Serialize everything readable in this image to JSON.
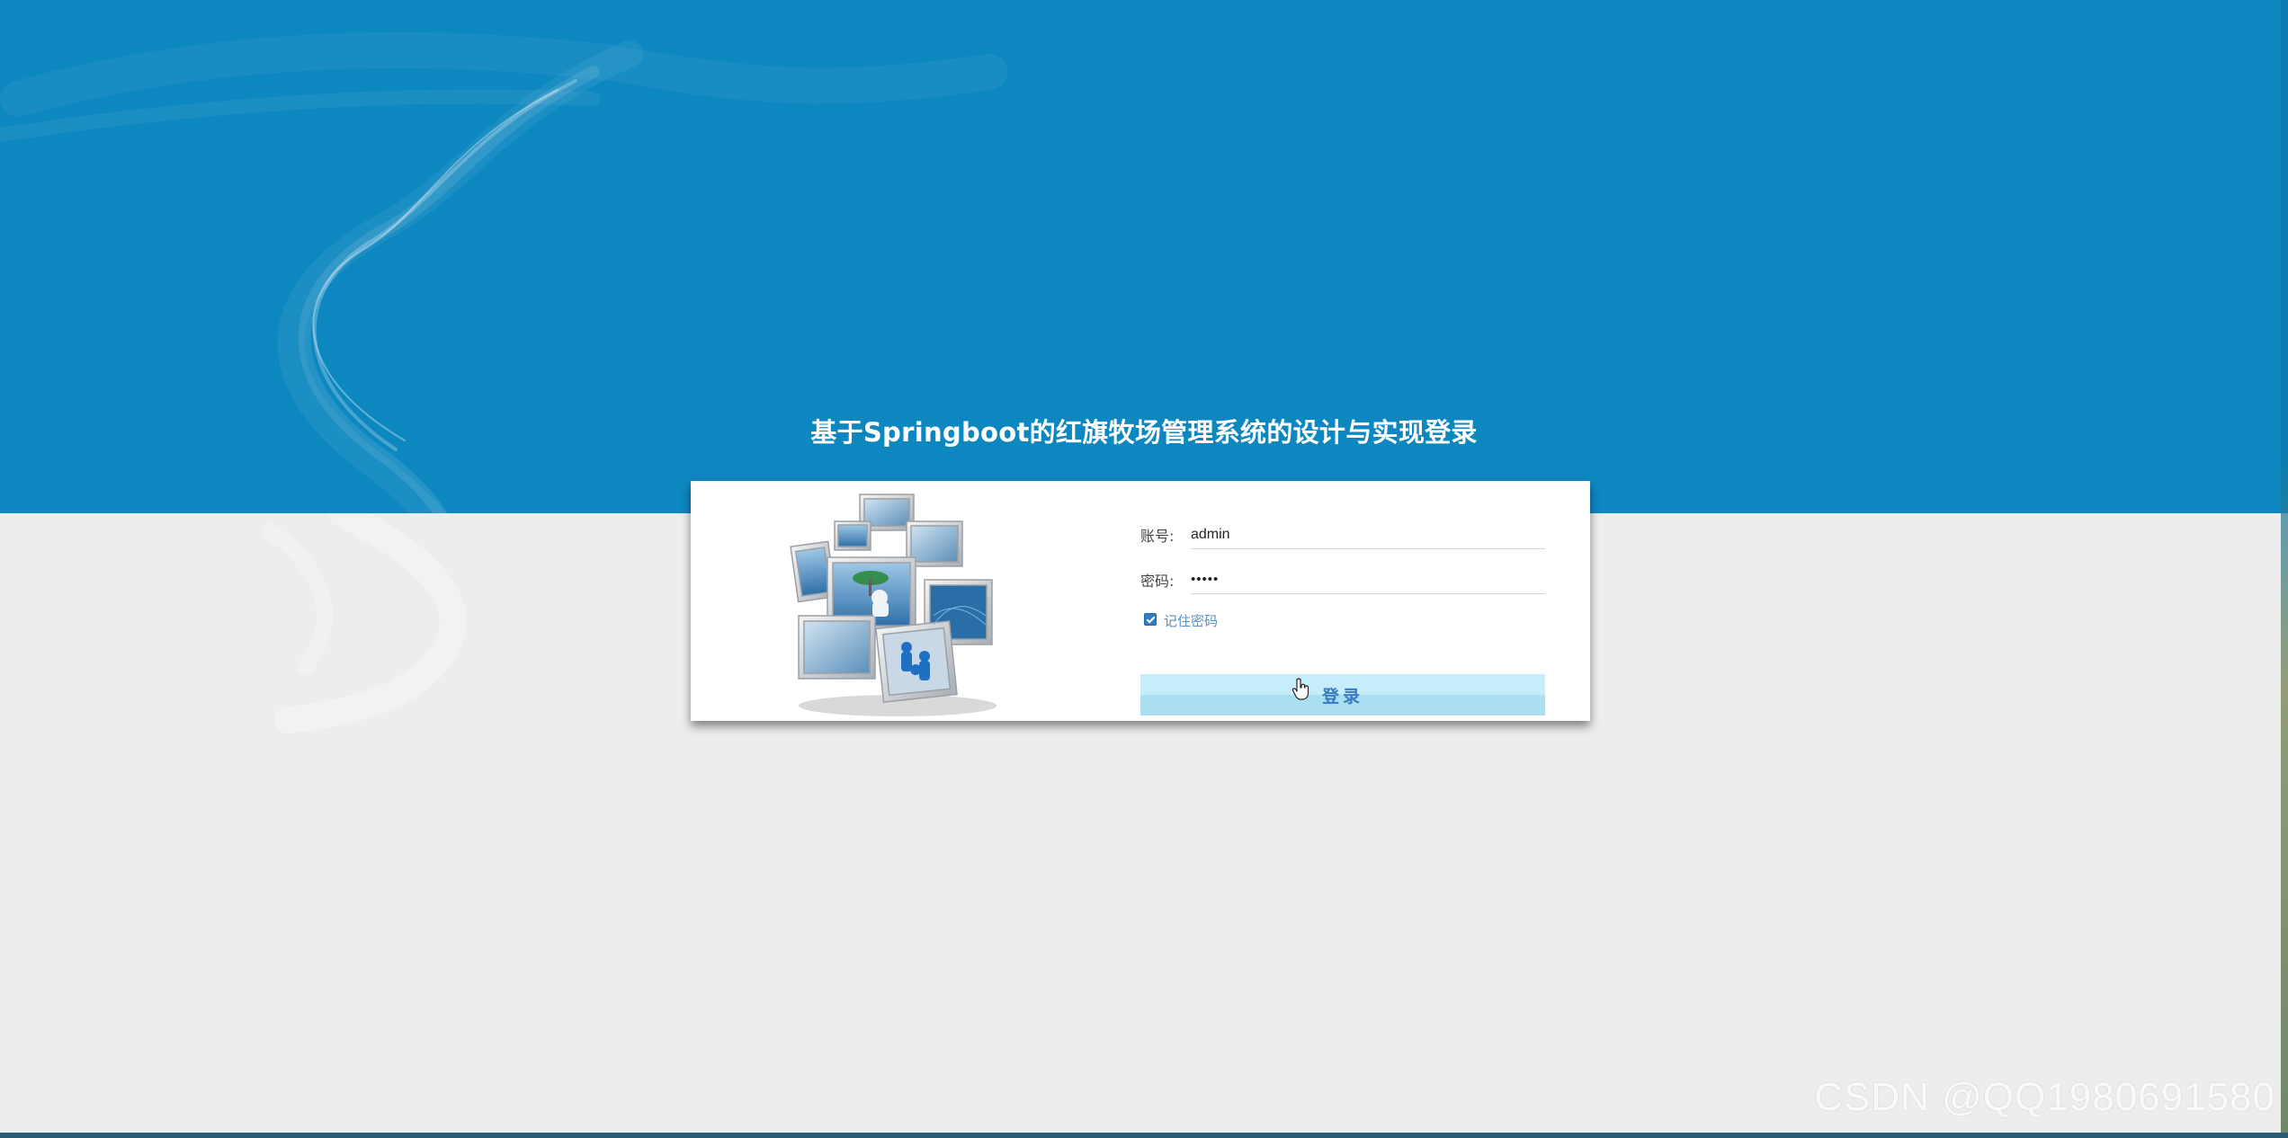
{
  "page": {
    "title": "基于Springboot的红旗牧场管理系统的设计与实现登录",
    "watermark": "CSDN @QQ1980691580"
  },
  "colors": {
    "top_band": "#0d87c0",
    "background": "#ededed",
    "button_light": "#c6eefa",
    "button_text": "#3a78c2",
    "checkbox": "#2d7fc1"
  },
  "login_form": {
    "username_label": "账号:",
    "username_value": "admin",
    "password_label": "密码:",
    "password_value": "•••••",
    "remember_label": "记住密码",
    "remember_checked": true,
    "submit_label": "登录"
  },
  "icons": {
    "illustration": "monitors-collage-illustration",
    "cursor": "hand-pointer-icon",
    "checkbox": "checkbox-checked-icon"
  }
}
